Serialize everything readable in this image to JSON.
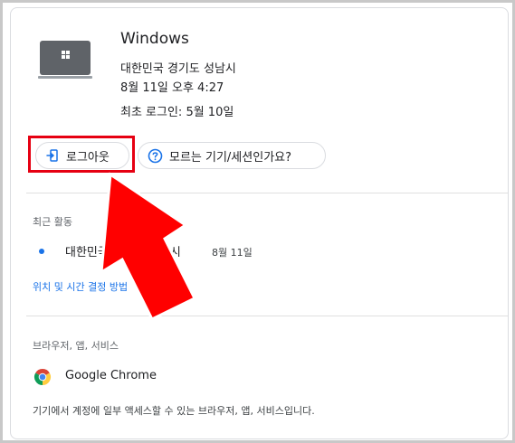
{
  "device": {
    "name": "Windows",
    "location": "대한민국 경기도 성남시",
    "last_seen": "8월 11일 오후 4:27",
    "first_login": "최초 로그인: 5월 10일"
  },
  "actions": {
    "logout_label": "로그아웃",
    "unknown_device_label": "모르는 기기/세션인가요?"
  },
  "recent_activity": {
    "title": "최근 활동",
    "location": "대한민국 경기도 성남시",
    "date": "8월 11일",
    "link": "위치 및 시간 결정 방법"
  },
  "services": {
    "title": "브라우저, 앱, 서비스",
    "app_name": "Google Chrome",
    "description": "기기에서 계정에 일부 액세스할 수 있는 브라우저, 앱, 서비스입니다."
  },
  "colors": {
    "accent": "#1a73e8",
    "highlight": "#e60012",
    "arrow": "#ff0000"
  }
}
